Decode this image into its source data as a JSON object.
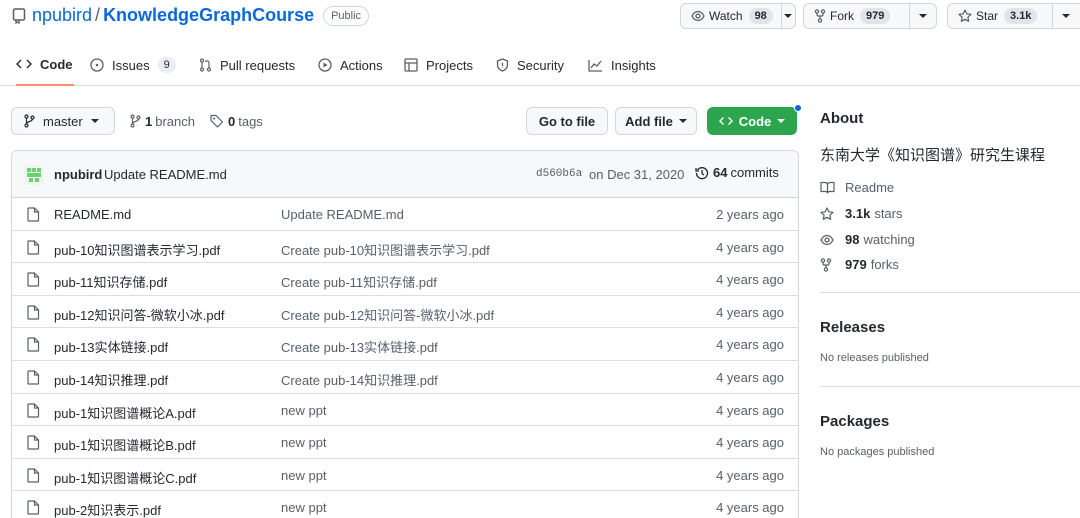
{
  "repo": {
    "owner": "npubird",
    "separator": "/",
    "name": "KnowledgeGraphCourse",
    "visibility": "Public"
  },
  "header_actions": {
    "watch": {
      "label": "Watch",
      "count": "98"
    },
    "fork": {
      "label": "Fork",
      "count": "979"
    },
    "star": {
      "label": "Star",
      "count": "3.1k"
    }
  },
  "tabs": [
    {
      "label": "Code",
      "icon": "code-icon",
      "active": true
    },
    {
      "label": "Issues",
      "icon": "issue-icon",
      "count": "9"
    },
    {
      "label": "Pull requests",
      "icon": "pull-request-icon"
    },
    {
      "label": "Actions",
      "icon": "play-icon"
    },
    {
      "label": "Projects",
      "icon": "table-icon"
    },
    {
      "label": "Security",
      "icon": "shield-icon"
    },
    {
      "label": "Insights",
      "icon": "graph-icon"
    }
  ],
  "branch_bar": {
    "branch": "master",
    "branches_count": "1",
    "branches_label": "branch",
    "tags_count": "0",
    "tags_label": "tags",
    "go_to_file": "Go to file",
    "add_file": "Add file",
    "code": "Code"
  },
  "latest_commit": {
    "author": "npubird",
    "message": "Update README.md",
    "sha": "d560b6a",
    "date": "on Dec 31, 2020",
    "commits_count": "64",
    "commits_label": "commits"
  },
  "files": [
    {
      "name": "README.md",
      "message": "Update README.md",
      "age": "2 years ago"
    },
    {
      "name": "pub-10知识图谱表示学习.pdf",
      "message": "Create pub-10知识图谱表示学习.pdf",
      "age": "4 years ago"
    },
    {
      "name": "pub-11知识存储.pdf",
      "message": "Create pub-11知识存储.pdf",
      "age": "4 years ago"
    },
    {
      "name": "pub-12知识问答-微软小冰.pdf",
      "message": "Create pub-12知识问答-微软小冰.pdf",
      "age": "4 years ago"
    },
    {
      "name": "pub-13实体链接.pdf",
      "message": "Create pub-13实体链接.pdf",
      "age": "4 years ago"
    },
    {
      "name": "pub-14知识推理.pdf",
      "message": "Create pub-14知识推理.pdf",
      "age": "4 years ago"
    },
    {
      "name": "pub-1知识图谱概论A.pdf",
      "message": "new ppt",
      "age": "4 years ago"
    },
    {
      "name": "pub-1知识图谱概论B.pdf",
      "message": "new ppt",
      "age": "4 years ago"
    },
    {
      "name": "pub-1知识图谱概论C.pdf",
      "message": "new ppt",
      "age": "4 years ago"
    },
    {
      "name": "pub-2知识表示.pdf",
      "message": "new ppt",
      "age": "4 years ago"
    }
  ],
  "about": {
    "heading": "About",
    "description": "东南大学《知识图谱》研究生课程",
    "readme": "Readme",
    "stars_count": "3.1k",
    "stars_label": "stars",
    "watching_count": "98",
    "watching_label": "watching",
    "forks_count": "979",
    "forks_label": "forks"
  },
  "releases": {
    "heading": "Releases",
    "empty": "No releases published"
  },
  "packages": {
    "heading": "Packages",
    "empty": "No packages published"
  },
  "colors": {
    "link": "#0969da",
    "primary_button": "#2da44e",
    "active_tab_underline": "#fd8c73"
  }
}
